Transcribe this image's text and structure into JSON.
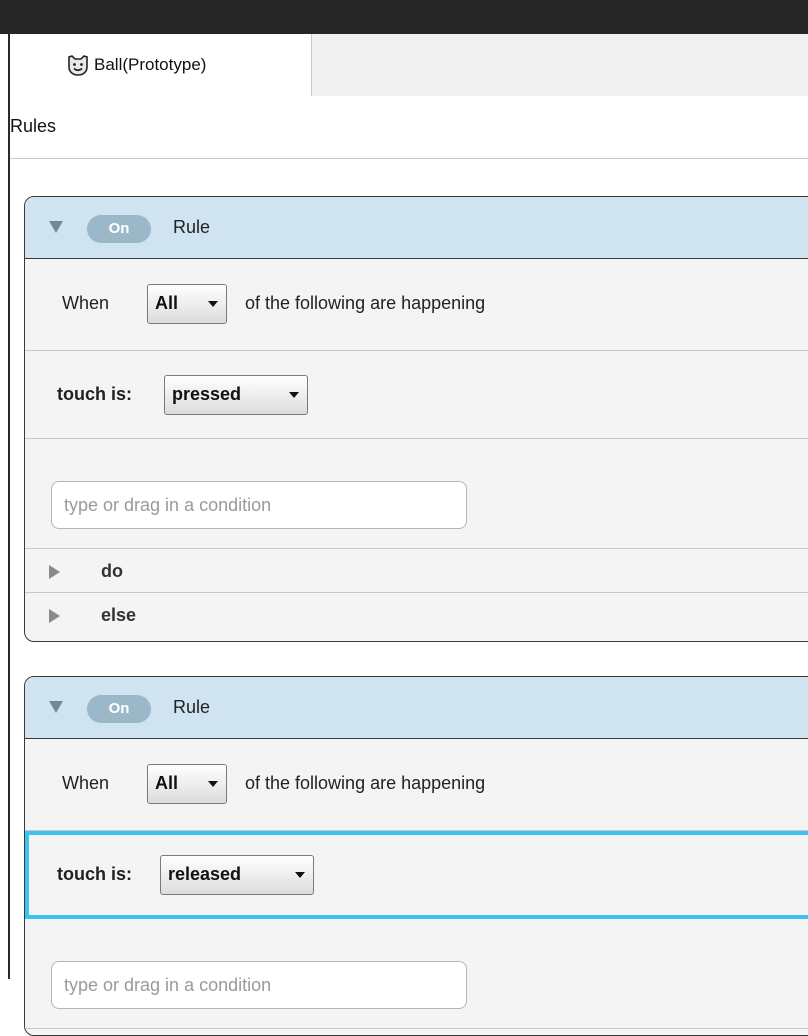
{
  "tab": {
    "icon": "face-icon",
    "label": "Ball(Prototype)"
  },
  "panel": {
    "title": "Rules"
  },
  "rules": [
    {
      "toggle_label": "On",
      "title": "Rule",
      "when_label": "When",
      "match_select": "All",
      "when_rest": "of the following are happening",
      "condition": {
        "label": "touch is:",
        "select": "pressed"
      },
      "input_placeholder": "type or drag in a condition",
      "sections": [
        "do",
        "else"
      ]
    },
    {
      "toggle_label": "On",
      "title": "Rule",
      "when_label": "When",
      "match_select": "All",
      "when_rest": "of the following are happening",
      "condition": {
        "label": "touch is:",
        "select": "released"
      },
      "input_placeholder": "type or drag in a condition"
    }
  ],
  "colors": {
    "selection": "#3cc3f0",
    "rule_header": "#cfe4f0",
    "toggle_on": "#9ab8c8"
  }
}
